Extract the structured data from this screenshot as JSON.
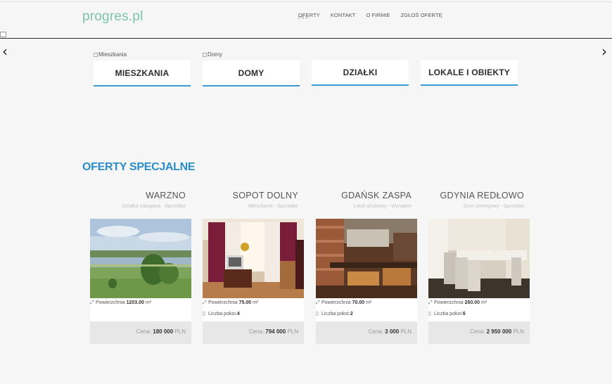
{
  "header": {
    "logo": "progres.pl",
    "nav": [
      "OFERTY",
      "KONTAKT",
      "O FIRMIE",
      "ZGŁOŚ OFERTĘ"
    ],
    "dots": "○○○"
  },
  "slider": {
    "prev": "‹",
    "next": "›"
  },
  "categories": [
    {
      "alt": "Mieszkania",
      "label": "MIESZKANIA"
    },
    {
      "alt": "Domy",
      "label": "DOMY"
    },
    {
      "alt": "",
      "label": "DZIAŁKI"
    },
    {
      "alt": "",
      "label": "LOKALE I OBIEKTY"
    }
  ],
  "special": {
    "title": "OFERTY SPECJALNE",
    "area_label": "Powierzchnia",
    "area_unit": "m²",
    "rooms_label": "Liczba pokoi:",
    "price_label": "Cena:",
    "cards": [
      {
        "title": "WARZNO",
        "subtitle": "Działka usługowa - Sprzedaż",
        "area": "1203.00",
        "rooms": "",
        "price": "180 000",
        "currency": "PLN"
      },
      {
        "title": "SOPOT DOLNY",
        "subtitle": "Mieszkanie - Sprzedaż",
        "area": "75.00",
        "rooms": "4",
        "price": "794 000",
        "currency": "PLN"
      },
      {
        "title": "GDAŃSK ZASPA",
        "subtitle": "Lokal użytkowy - Wynajem",
        "area": "70.00",
        "rooms": "2",
        "price": "3 000",
        "currency": "PLN"
      },
      {
        "title": "GDYNIA REDŁOWO",
        "subtitle": "Dom szeregowy - Sprzedaż",
        "area": "260.00",
        "rooms": "6",
        "price": "2 950 000",
        "currency": "PLN"
      }
    ]
  }
}
